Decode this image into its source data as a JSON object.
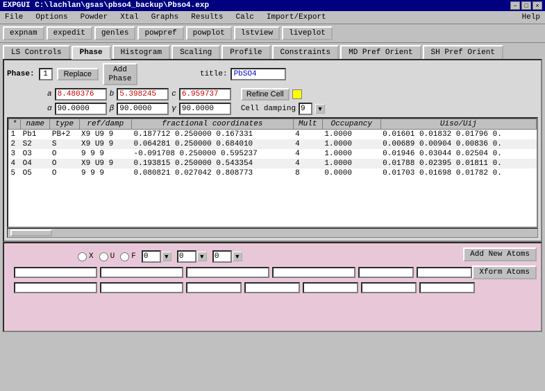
{
  "titlebar": {
    "label": "EXPGUI C:\\lachlan\\gsas\\pbso4_backup\\Pbso4.exp",
    "min": "−",
    "max": "□",
    "close": "×"
  },
  "menu": {
    "items": [
      "File",
      "Options",
      "Powder",
      "Xtal",
      "Graphs",
      "Results",
      "Calc",
      "Import/Export",
      "Help"
    ]
  },
  "toolbar": {
    "buttons": [
      "expnam",
      "expedit",
      "genles",
      "powpref",
      "powplot",
      "lstview",
      "liveplot"
    ]
  },
  "tabs": {
    "items": [
      "LS Controls",
      "Phase",
      "Histogram",
      "Scaling",
      "Profile",
      "Constraints",
      "MD Pref Orient",
      "SH Pref Orient"
    ],
    "active": "Phase"
  },
  "phase": {
    "label": "Phase:",
    "number": "1",
    "replace_label": "Replace",
    "title_label": "title:",
    "title_value": "PbSO4",
    "add_phase_label": "Add\nPhase"
  },
  "cell": {
    "a_label": "a",
    "a_value": "8.480376",
    "b_label": "b",
    "b_value": "5.398245",
    "c_label": "c",
    "c_value": "6.959737",
    "alpha_label": "α",
    "alpha_value": "90.0000",
    "beta_label": "β",
    "beta_value": "90.0000",
    "gamma_label": "γ",
    "gamma_value": "90.0000",
    "refine_cell": "Refine Cell",
    "cell_damping": "Cell damping",
    "damping_value": "9"
  },
  "table": {
    "headers": [
      "*",
      "name",
      "type",
      "ref/damp",
      "fractional coordinates",
      "Mult",
      "Occupancy",
      "Uiso/Uij"
    ],
    "rows": [
      {
        "num": "1",
        "name": "Pb1",
        "type": "PB+2",
        "ref": "X9 U9 9",
        "coords": "0.187712  0.250000  0.167331",
        "mult": "4",
        "occ": "1.0000",
        "uiso": "0.01601  0.01832  0.01796  0."
      },
      {
        "num": "2",
        "name": "S2",
        "type": "S",
        "ref": "X9 U9 9",
        "coords": "0.064281  0.250000  0.684010",
        "mult": "4",
        "occ": "1.0000",
        "uiso": "0.00689  0.00904  0.00836  0."
      },
      {
        "num": "3",
        "name": "O3",
        "type": "O",
        "ref": "9 9 9",
        "coords": "-0.091708  0.250000  0.595237",
        "mult": "4",
        "occ": "1.0000",
        "uiso": "0.01946  0.03044  0.02504  0."
      },
      {
        "num": "4",
        "name": "O4",
        "type": "O",
        "ref": "X9 U9 9",
        "coords": "0.193815  0.250000  0.543354",
        "mult": "4",
        "occ": "1.0000",
        "uiso": "0.01788  0.02395  0.01811  0."
      },
      {
        "num": "5",
        "name": "O5",
        "type": "O",
        "ref": "9 9 9",
        "coords": "0.080821  0.027042  0.808773",
        "mult": "8",
        "occ": "0.0000",
        "uiso": "0.01703  0.01698  0.01782  0."
      }
    ]
  },
  "bottom": {
    "add_new_atoms": "Add New Atoms",
    "xform_atoms": "Xform Atoms",
    "x_label": "X",
    "u_label": "U",
    "f_label": "F",
    "num1": "0",
    "num2": "0",
    "num3": "0"
  }
}
